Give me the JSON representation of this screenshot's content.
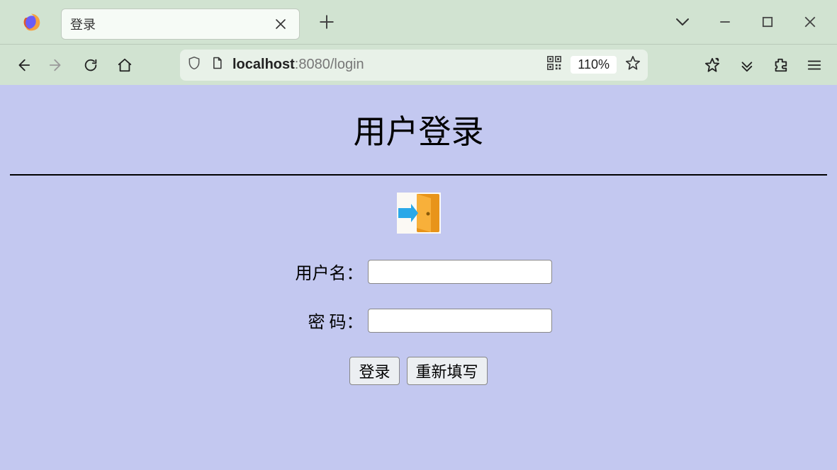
{
  "browser": {
    "tab_title": "登录",
    "url_display_host": "localhost",
    "url_display_port": ":8080",
    "url_display_path": "/login",
    "zoom": "110%"
  },
  "page": {
    "title": "用户登录",
    "username_label": "用户名：",
    "password_label": "密 码：",
    "username_value": "",
    "password_value": "",
    "submit_label": "登录",
    "reset_label": "重新填写"
  }
}
